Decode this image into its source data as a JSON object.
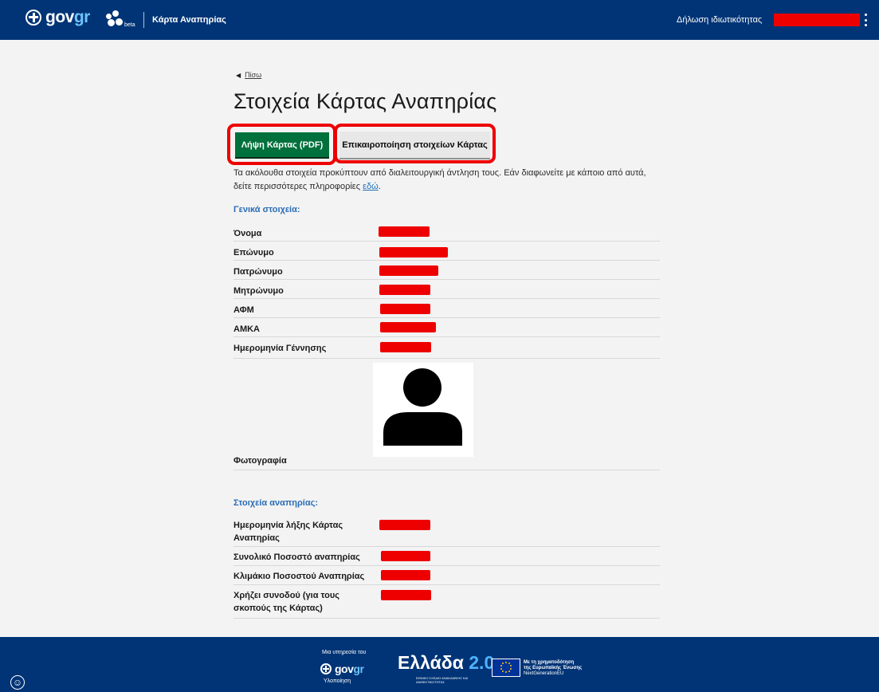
{
  "header": {
    "brand_main": "gov",
    "brand_accent": "gr",
    "beta_label": "beta",
    "service_name": "Κάρτα Αναπηρίας",
    "privacy_link": "Δήλωση ιδιωτικότητας"
  },
  "main": {
    "back_label": "Πίσω",
    "title": "Στοιχεία Κάρτας Αναπηρίας",
    "download_button": "Λήψη Κάρτας (PDF)",
    "update_button": "Επικαιροποίηση στοιχείων Κάρτας",
    "intro_text": "Τα ακόλουθα στοιχεία προκύπτουν από διαλειτουργική άντληση τους. Εάν διαφωνείτε με κάποιο από αυτά, δείτε περισσότερες πληροφορίες ",
    "intro_link": "εδώ",
    "intro_end": "."
  },
  "general": {
    "title": "Γενικά στοιχεία:",
    "rows": [
      {
        "label": "Όνομα"
      },
      {
        "label": "Επώνυμο"
      },
      {
        "label": "Πατρώνυμο"
      },
      {
        "label": "Μητρώνυμο"
      },
      {
        "label": "ΑΦΜ"
      },
      {
        "label": "ΑΜΚΑ"
      },
      {
        "label": "Ημερομηνία Γέννησης"
      }
    ],
    "photo_label": "Φωτογραφία"
  },
  "disability": {
    "title": "Στοιχεία αναπηρίας:",
    "rows": [
      {
        "label": "Ημερομηνία λήξης Κάρτας Αναπηρίας"
      },
      {
        "label": "Συνολικό Ποσοστό αναπηρίας"
      },
      {
        "label": "Κλιμάκιο Ποσοστού Αναπηρίας"
      },
      {
        "label": "Χρήζει συνοδού (για τους σκοπούς της Κάρτας)"
      }
    ]
  },
  "footer": {
    "service_of": "Μια υπηρεσία του",
    "brand_main": "gov",
    "brand_accent": "gr",
    "implementation": "Υλοποίηση",
    "greece_word": "Ελλάδα",
    "greece_num": "2.0",
    "greece_sub": "ΕΘΝΙΚΟ ΣΧΕΔΙΟ ΑΝΑΚΑΜΨΗΣ ΚΑΙ ΑΝΘΕΚΤΙΚΟΤΗΤΑΣ",
    "eu_line1": "Με τη χρηματοδότηση",
    "eu_line2": "της Ευρωπαϊκής Ένωσης",
    "eu_line3": "NextGenerationEU"
  },
  "colors": {
    "header_bg": "#003476",
    "primary_button": "#00703c",
    "section_title": "#2a6db5",
    "redaction": "#ee0000"
  },
  "icons": [
    "greek-seal-icon",
    "beta-logo-icon",
    "kebab-menu-icon",
    "back-arrow-icon",
    "person-placeholder-icon",
    "eu-flag-icon",
    "accessibility-icon"
  ]
}
